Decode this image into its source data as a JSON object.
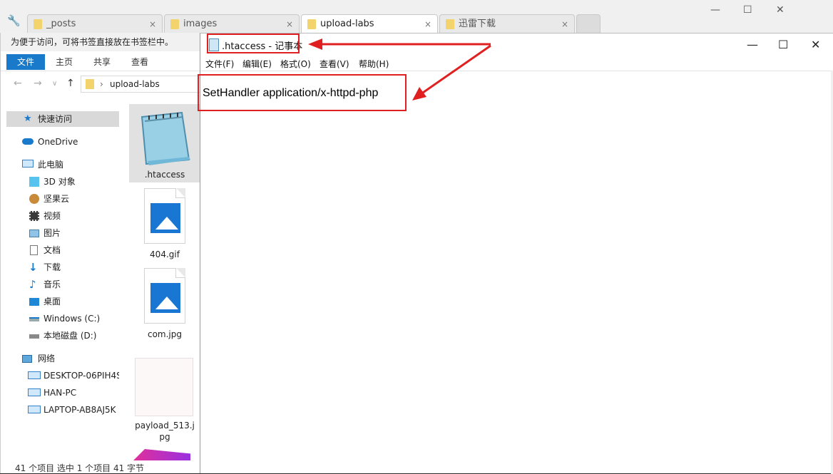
{
  "browser": {
    "tabs": [
      {
        "label": "_posts"
      },
      {
        "label": "images"
      },
      {
        "label": "upload-labs"
      },
      {
        "label": "迅雷下载"
      }
    ],
    "close_glyph": "×"
  },
  "explorer": {
    "bookmark_bar_text": "为便于访问，可将书签直接放在书签栏中。",
    "ribbon_tabs": [
      "文件",
      "主页",
      "共享",
      "查看"
    ],
    "address": "upload-labs",
    "nav": {
      "quick_access": "快速访问",
      "onedrive": "OneDrive",
      "this_pc": "此电脑",
      "objects_3d": "3D 对象",
      "jianguoyun": "坚果云",
      "videos": "视频",
      "pictures": "图片",
      "documents": "文档",
      "downloads": "下载",
      "music": "音乐",
      "desktop": "桌面",
      "drive_c": "Windows (C:)",
      "drive_d": "本地磁盘 (D:)",
      "network": "网络",
      "pc1": "DESKTOP-06PIH4S",
      "pc2": "HAN-PC",
      "pc3": "LAPTOP-AB8AJ5K"
    },
    "files": [
      {
        "name": ".htaccess",
        "icon": "notepad-icon"
      },
      {
        "name": "404.gif",
        "icon": "image-icon"
      },
      {
        "name": "com.jpg",
        "icon": "image-icon"
      },
      {
        "name": "payload_513.j",
        "name2": "pg",
        "icon": "blank-image-icon"
      }
    ],
    "status": "41 个项目    选中 1 个项目  41 字节"
  },
  "notepad": {
    "title": ".htaccess - 记事本",
    "menu": [
      "文件(F)",
      "编辑(E)",
      "格式(O)",
      "查看(V)",
      "帮助(H)"
    ],
    "content": "SetHandler application/x-httpd-php"
  },
  "colors": {
    "annotation": "#e02020",
    "ribbon_file": "#1979ca"
  }
}
